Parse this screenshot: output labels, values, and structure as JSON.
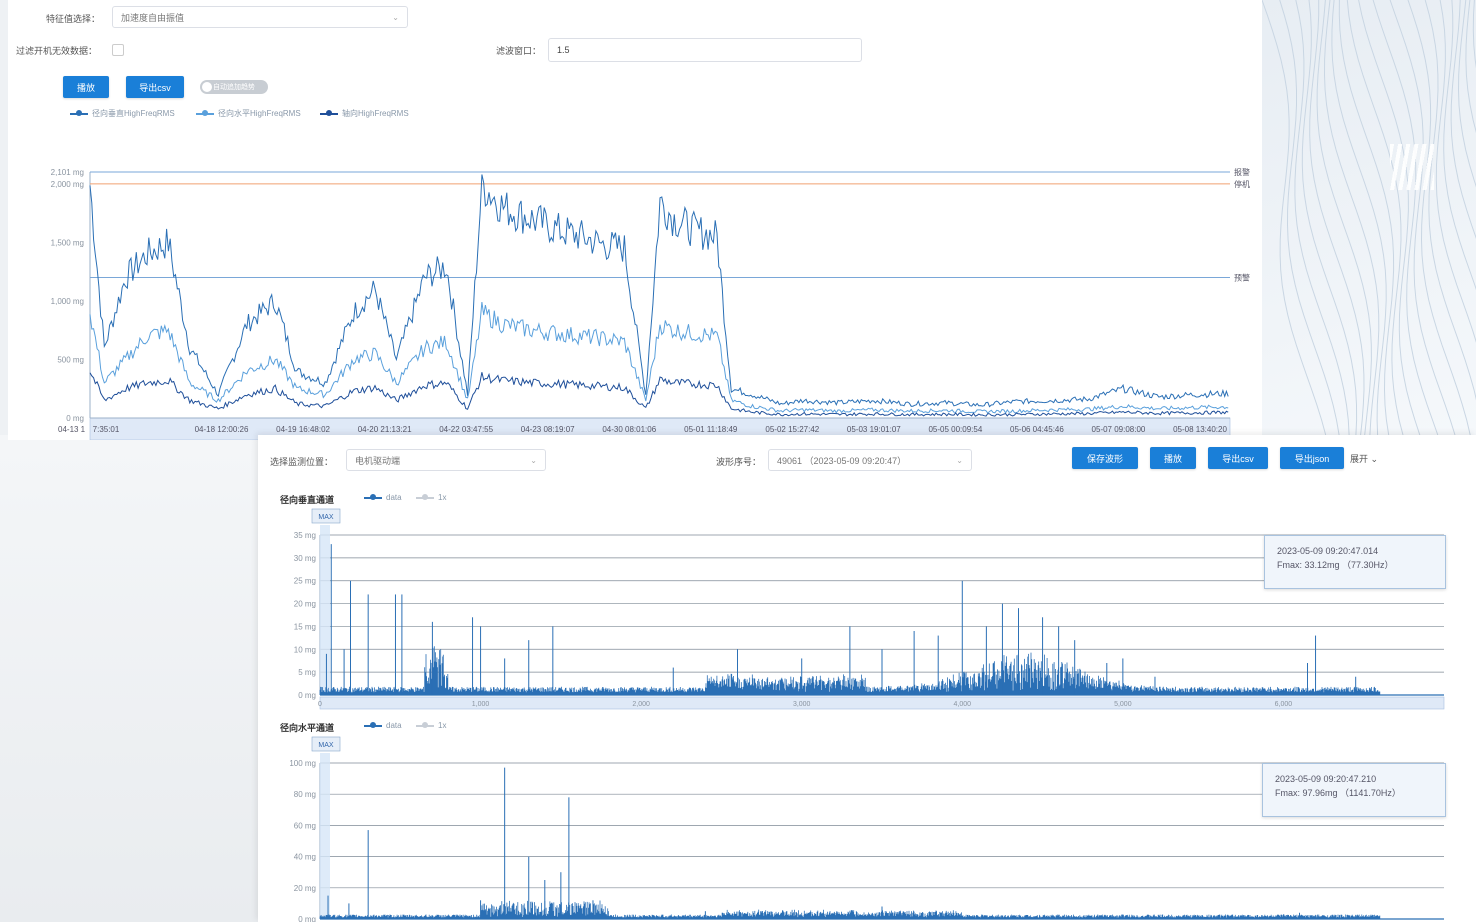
{
  "top": {
    "feature_label": "特征值选择：",
    "feature_value": "加速度自由振值",
    "filter_label": "过滤开机无效数据：",
    "window_label": "滤波窗口：",
    "window_value": "1.5",
    "buttons": [
      "播放",
      "导出csv"
    ],
    "toggle_label": "自动追加趋势",
    "legend": [
      {
        "name": "径向垂直HighFreqRMS",
        "color": "#2a6fb5"
      },
      {
        "name": "径向水平HighFreqRMS",
        "color": "#5aa0dc"
      },
      {
        "name": "轴向HighFreqRMS",
        "color": "#1f4f9a"
      }
    ],
    "right_labels": [
      "报警",
      "停机",
      "预警"
    ]
  },
  "bottom": {
    "position_label": "选择监测位置：",
    "position_value": "电机驱动端",
    "wave_label": "波形序号：",
    "wave_value": "49061 （2023-05-09 09:20:47）",
    "buttons": [
      "保存波形",
      "播放",
      "导出csv",
      "导出json"
    ],
    "expand_label": "展开",
    "chart1": {
      "title": "径向垂直通道",
      "legend": [
        "data",
        "1x"
      ],
      "zoom_label": "MAX",
      "tooltip_time": "2023-05-09 09:20:47.014",
      "tooltip_fmax": "Fmax: 33.12mg （77.30Hz）"
    },
    "chart2": {
      "title": "径向水平通道",
      "legend": [
        "data",
        "1x"
      ],
      "zoom_label": "MAX",
      "tooltip_time": "2023-05-09 09:20:47.210",
      "tooltip_fmax": "Fmax: 97.96mg （1141.70Hz）"
    }
  },
  "chart_data": [
    {
      "type": "line",
      "title": "",
      "y_ticks": [
        "0 mg",
        "500 mg",
        "1,000 mg",
        "1,500 mg",
        "2,000 mg",
        "2,101 mg"
      ],
      "ylim": [
        0,
        2101
      ],
      "x_ticks": [
        "04-13 1",
        "7:35:01",
        "04-18 12:00:26",
        "04-19 16:48:02",
        "04-20 21:13:21",
        "04-22 03:47:55",
        "04-23 08:19:07",
        "04-30 08:01:06",
        "05-01 11:18:49",
        "05-02 15:27:42",
        "05-03 19:01:07",
        "05-05 00:09:54",
        "05-06 04:45:46",
        "05-07 09:08:00",
        "05-08 13:40:20"
      ],
      "thresholds": [
        {
          "label": "报警",
          "value": 2101,
          "color": "#7aa7d8"
        },
        {
          "label": "停机",
          "value": 2000,
          "color": "#f0a070"
        },
        {
          "label": "预警",
          "value": 1200,
          "color": "#7aa7d8"
        }
      ],
      "series": [
        {
          "name": "径向垂直HighFreqRMS",
          "color": "#2a6fb5",
          "segments": [
            [
              0,
              1990
            ],
            [
              2,
              600
            ],
            [
              5,
              1200
            ],
            [
              8,
              1400
            ],
            [
              11,
              1500
            ],
            [
              14,
              600
            ],
            [
              18,
              200
            ],
            [
              22,
              800
            ],
            [
              26,
              1000
            ],
            [
              29,
              400
            ],
            [
              33,
              300
            ],
            [
              37,
              900
            ],
            [
              40,
              1100
            ],
            [
              43,
              500
            ],
            [
              47,
              1200
            ],
            [
              50,
              1300
            ],
            [
              53,
              200
            ],
            [
              55,
              2000
            ],
            [
              58,
              1800
            ],
            [
              62,
              1700
            ],
            [
              66,
              1600
            ],
            [
              69,
              1550
            ],
            [
              72,
              1480
            ],
            [
              75,
              1450
            ],
            [
              78,
              200
            ],
            [
              80,
              1850
            ],
            [
              82,
              1700
            ],
            [
              85,
              1600
            ],
            [
              88,
              1550
            ],
            [
              90,
              250
            ],
            [
              93,
              200
            ],
            [
              97,
              120
            ],
            [
              100,
              150
            ],
            [
              105,
              130
            ],
            [
              110,
              150
            ],
            [
              115,
              120
            ],
            [
              120,
              130
            ],
            [
              125,
              110
            ],
            [
              130,
              140
            ],
            [
              135,
              150
            ],
            [
              140,
              160
            ],
            [
              145,
              250
            ],
            [
              150,
              180
            ],
            [
              155,
              200
            ],
            [
              160,
              210
            ]
          ]
        },
        {
          "name": "径向水平HighFreqRMS",
          "color": "#5aa0dc",
          "segments": [
            [
              0,
              900
            ],
            [
              2,
              300
            ],
            [
              5,
              500
            ],
            [
              8,
              700
            ],
            [
              11,
              750
            ],
            [
              14,
              300
            ],
            [
              18,
              150
            ],
            [
              22,
              400
            ],
            [
              26,
              500
            ],
            [
              29,
              250
            ],
            [
              33,
              200
            ],
            [
              37,
              500
            ],
            [
              40,
              550
            ],
            [
              43,
              300
            ],
            [
              47,
              600
            ],
            [
              50,
              650
            ],
            [
              53,
              150
            ],
            [
              55,
              900
            ],
            [
              58,
              800
            ],
            [
              62,
              750
            ],
            [
              66,
              720
            ],
            [
              69,
              700
            ],
            [
              72,
              680
            ],
            [
              75,
              650
            ],
            [
              78,
              150
            ],
            [
              80,
              800
            ],
            [
              82,
              750
            ],
            [
              85,
              720
            ],
            [
              88,
              700
            ],
            [
              90,
              150
            ],
            [
              93,
              100
            ],
            [
              97,
              60
            ],
            [
              100,
              70
            ],
            [
              105,
              60
            ],
            [
              110,
              70
            ],
            [
              115,
              60
            ],
            [
              120,
              65
            ],
            [
              125,
              55
            ],
            [
              130,
              60
            ],
            [
              135,
              70
            ],
            [
              140,
              75
            ],
            [
              145,
              100
            ],
            [
              150,
              80
            ],
            [
              155,
              90
            ],
            [
              160,
              95
            ]
          ]
        },
        {
          "name": "轴向HighFreqRMS",
          "color": "#1f4f9a",
          "segments": [
            [
              0,
              400
            ],
            [
              2,
              150
            ],
            [
              5,
              250
            ],
            [
              8,
              300
            ],
            [
              11,
              320
            ],
            [
              14,
              150
            ],
            [
              18,
              80
            ],
            [
              22,
              200
            ],
            [
              26,
              250
            ],
            [
              29,
              120
            ],
            [
              33,
              100
            ],
            [
              37,
              230
            ],
            [
              40,
              260
            ],
            [
              43,
              150
            ],
            [
              47,
              280
            ],
            [
              50,
              300
            ],
            [
              53,
              80
            ],
            [
              55,
              350
            ],
            [
              58,
              320
            ],
            [
              62,
              300
            ],
            [
              66,
              290
            ],
            [
              69,
              280
            ],
            [
              72,
              270
            ],
            [
              75,
              260
            ],
            [
              78,
              80
            ],
            [
              80,
              330
            ],
            [
              82,
              300
            ],
            [
              85,
              290
            ],
            [
              88,
              280
            ],
            [
              90,
              80
            ],
            [
              93,
              50
            ],
            [
              97,
              30
            ],
            [
              100,
              35
            ],
            [
              105,
              30
            ],
            [
              110,
              35
            ],
            [
              115,
              30
            ],
            [
              120,
              32
            ],
            [
              125,
              28
            ],
            [
              130,
              30
            ],
            [
              135,
              35
            ],
            [
              140,
              38
            ],
            [
              145,
              50
            ],
            [
              150,
              40
            ],
            [
              155,
              45
            ],
            [
              160,
              48
            ]
          ]
        }
      ]
    },
    {
      "type": "bar",
      "title": "径向垂直通道",
      "y_ticks": [
        "0 mg",
        "5 mg",
        "10 mg",
        "15 mg",
        "20 mg",
        "25 mg",
        "30 mg",
        "35 mg"
      ],
      "ylim": [
        0,
        35
      ],
      "x_ticks": [
        "0",
        "1,000",
        "2,000",
        "3,000",
        "4,000",
        "5,000",
        "6,000"
      ],
      "xlim": [
        0,
        7000
      ],
      "peaks": [
        [
          40,
          9
        ],
        [
          70,
          33
        ],
        [
          150,
          10
        ],
        [
          190,
          25
        ],
        [
          300,
          22
        ],
        [
          470,
          22
        ],
        [
          510,
          22
        ],
        [
          700,
          16
        ],
        [
          950,
          17
        ],
        [
          1000,
          15
        ],
        [
          1150,
          8
        ],
        [
          1300,
          12
        ],
        [
          1450,
          15
        ],
        [
          2200,
          6
        ],
        [
          2600,
          10
        ],
        [
          3000,
          8
        ],
        [
          3300,
          15
        ],
        [
          3500,
          10
        ],
        [
          3700,
          14
        ],
        [
          3850,
          13
        ],
        [
          4000,
          25
        ],
        [
          4150,
          15
        ],
        [
          4250,
          20
        ],
        [
          4350,
          19
        ],
        [
          4500,
          17
        ],
        [
          4600,
          15
        ],
        [
          4700,
          12
        ],
        [
          4900,
          7
        ],
        [
          5200,
          4
        ],
        [
          5000,
          8
        ],
        [
          6150,
          7
        ],
        [
          6200,
          13
        ],
        [
          6450,
          4
        ]
      ],
      "peak_value": 33.12,
      "peak_freq": 77.3
    },
    {
      "type": "bar",
      "title": "径向水平通道",
      "y_ticks": [
        "0 mg",
        "20 mg",
        "40 mg",
        "60 mg",
        "80 mg",
        "100 mg"
      ],
      "ylim": [
        0,
        100
      ],
      "xlim": [
        0,
        7000
      ],
      "peaks": [
        [
          50,
          15
        ],
        [
          180,
          10
        ],
        [
          300,
          57
        ],
        [
          1150,
          97
        ],
        [
          1300,
          40
        ],
        [
          1400,
          25
        ],
        [
          1500,
          30
        ],
        [
          1550,
          78
        ],
        [
          1700,
          12
        ],
        [
          1000,
          12
        ],
        [
          2400,
          5
        ],
        [
          3500,
          8
        ],
        [
          5000,
          3
        ],
        [
          6000,
          3
        ],
        [
          6100,
          4
        ]
      ],
      "peak_value": 97.96,
      "peak_freq": 1141.7
    }
  ]
}
